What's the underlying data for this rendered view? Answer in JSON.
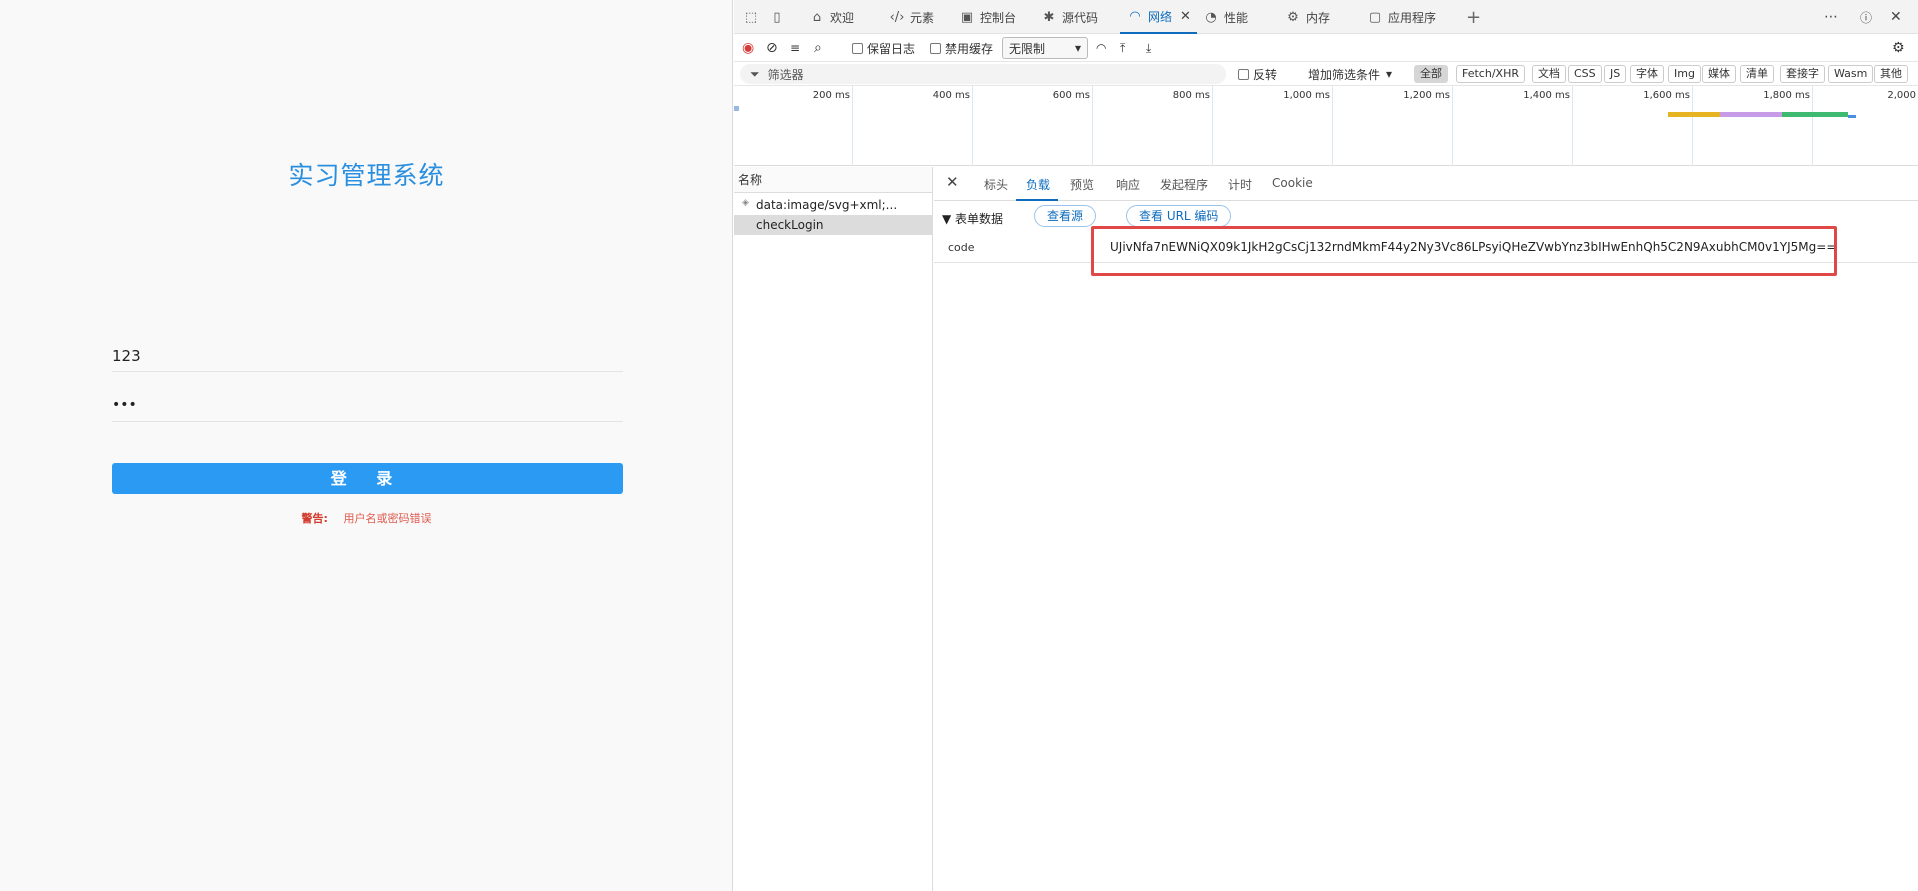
{
  "login": {
    "title": "实习管理系统",
    "username_value": "123",
    "password_value": "•••",
    "submit_label": "登 录",
    "warning_label": "警告:",
    "warning_text": "用户名或密码错误"
  },
  "devtools": {
    "tabs": [
      {
        "label": "欢迎",
        "icon": "home-icon"
      },
      {
        "label": "元素",
        "icon": "code-icon"
      },
      {
        "label": "控制台",
        "icon": "console-icon"
      },
      {
        "label": "源代码",
        "icon": "bug-icon"
      },
      {
        "label": "网络",
        "icon": "wifi-icon"
      },
      {
        "label": "性能",
        "icon": "gauge-icon"
      },
      {
        "label": "内存",
        "icon": "memory-icon"
      },
      {
        "label": "应用程序",
        "icon": "app-icon"
      }
    ],
    "toolbar": {
      "preserve_log": "保留日志",
      "disable_cache": "禁用缓存",
      "throttle": "无限制"
    },
    "filter": {
      "placeholder": "筛选器",
      "invert": "反转",
      "more_filters": "增加筛选条件",
      "types": [
        "全部",
        "Fetch/XHR",
        "文档",
        "CSS",
        "JS",
        "字体",
        "Img",
        "媒体",
        "清单",
        "套接字",
        "Wasm",
        "其他"
      ]
    },
    "timeline": {
      "ticks": [
        "200 ms",
        "400 ms",
        "600 ms",
        "800 ms",
        "1,000 ms",
        "1,200 ms",
        "1,400 ms",
        "1,600 ms",
        "1,800 ms",
        "2,000"
      ]
    },
    "requests": {
      "header": "名称",
      "rows": [
        "data:image/svg+xml;...",
        "checkLogin"
      ]
    },
    "detail": {
      "tabs": [
        "标头",
        "负载",
        "预览",
        "响应",
        "发起程序",
        "计时",
        "Cookie"
      ],
      "section_title": "▼ 表单数据",
      "view_source": "查看源",
      "view_url_encoded": "查看 URL 编码",
      "field_key": "code",
      "field_value": "UJivNfa7nEWNiQX09k1JkH2gCsCj132rndMkmF44y2Ny3Vc86LPsyiQHeZVwbYnz3bIHwEnhQh5C2N9AxubhCM0v1YJ5Mg=="
    }
  }
}
